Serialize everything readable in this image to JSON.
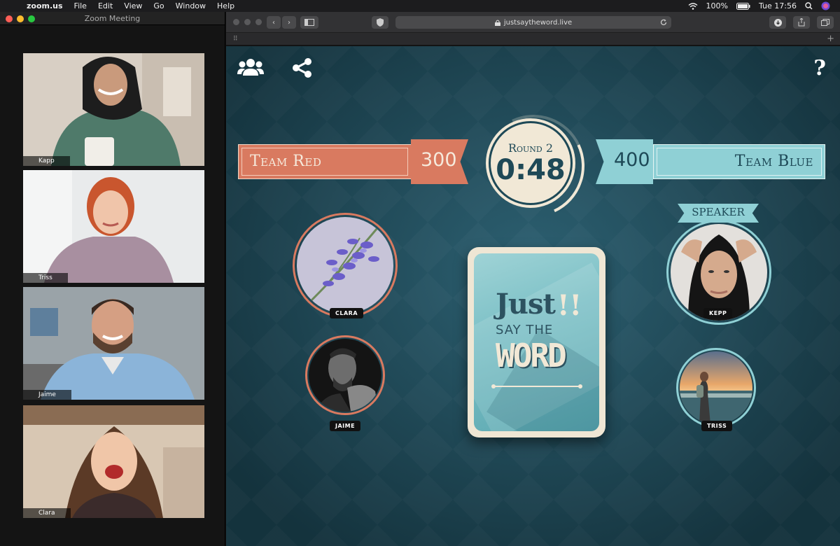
{
  "menubar": {
    "app": "zoom.us",
    "items": [
      "File",
      "Edit",
      "View",
      "Go",
      "Window",
      "Help"
    ],
    "battery": "100%",
    "clock": "Tue 17:56"
  },
  "zoom": {
    "window_title": "Zoom Meeting",
    "participants": [
      {
        "name": "Kapp"
      },
      {
        "name": "Triss"
      },
      {
        "name": "Jaime"
      },
      {
        "name": "Clara"
      }
    ]
  },
  "browser": {
    "url": "justsaytheword.live"
  },
  "game": {
    "team_red": {
      "name": "Team Red",
      "score": "300",
      "color": "#d97a60"
    },
    "team_blue": {
      "name": "Team Blue",
      "score": "400",
      "color": "#8fd0d5"
    },
    "round_label": "Round 2",
    "timer": "0:48",
    "speaker_label": "SPEAKER",
    "card_logo": {
      "line1": "Just",
      "bang": "!!",
      "line2": "SAY THE",
      "line3": "WORD"
    },
    "players": {
      "clara": "CLARA",
      "jaime": "JAIME",
      "kepp": "KEPP",
      "triss": "TRISS"
    }
  }
}
